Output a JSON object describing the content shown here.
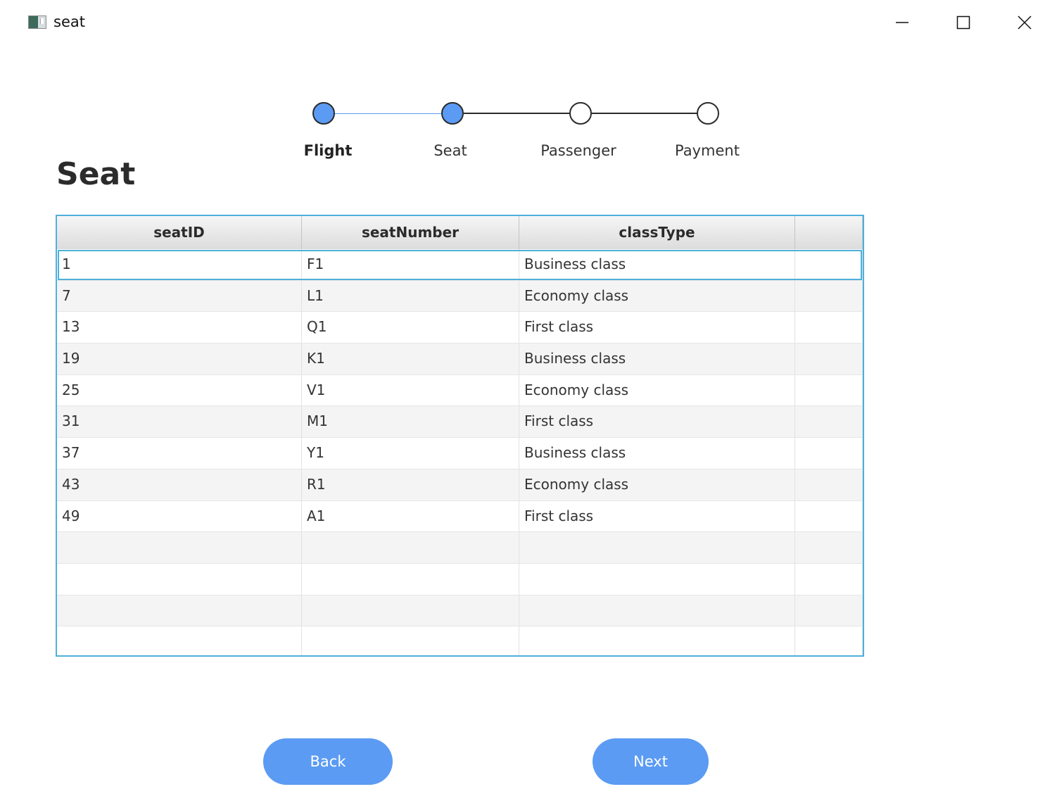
{
  "window": {
    "title": "seat",
    "icons": [
      "app-icon",
      "minimize-icon",
      "maximize-icon",
      "close-icon"
    ]
  },
  "stepper": {
    "steps": [
      {
        "label": "Flight",
        "completed": true
      },
      {
        "label": "Seat",
        "completed": true
      },
      {
        "label": "Passenger",
        "completed": false
      },
      {
        "label": "Payment",
        "completed": false
      }
    ],
    "active_color": "#5b9bf3",
    "line_completed_color": "#5b9bf3",
    "line_pending_color": "#2a2a2a"
  },
  "page": {
    "title": "Seat"
  },
  "table": {
    "columns": [
      "seatID",
      "seatNumber",
      "classType",
      ""
    ],
    "rows": [
      [
        "1",
        "F1",
        "Business class"
      ],
      [
        "7",
        "L1",
        "Economy class"
      ],
      [
        "13",
        "Q1",
        "First class"
      ],
      [
        "19",
        "K1",
        "Business class"
      ],
      [
        "25",
        "V1",
        "Economy class"
      ],
      [
        "31",
        "M1",
        "First class"
      ],
      [
        "37",
        "Y1",
        "Business class"
      ],
      [
        "43",
        "R1",
        "Economy class"
      ],
      [
        "49",
        "A1",
        "First class"
      ]
    ],
    "selected_row": 0,
    "accent": "#4fb0db"
  },
  "buttons": {
    "back_label": "Back",
    "next_label": "Next",
    "color": "#5b9bf3"
  }
}
